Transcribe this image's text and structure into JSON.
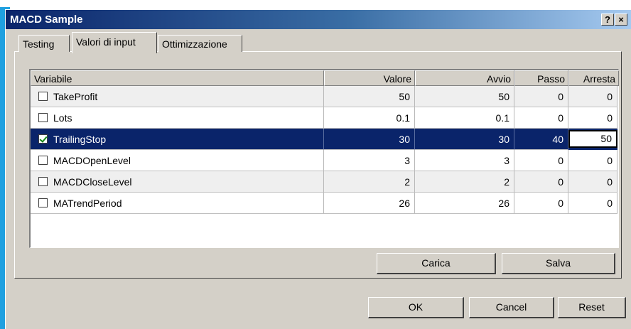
{
  "window": {
    "title": "MACD Sample",
    "help_label": "?",
    "close_label": "×"
  },
  "tabs": [
    {
      "label": "Testing"
    },
    {
      "label": "Valori di input"
    },
    {
      "label": "Ottimizzazione"
    }
  ],
  "table": {
    "columns": [
      "Variabile",
      "Valore",
      "Avvio",
      "Passo",
      "Arresta"
    ],
    "rows": [
      {
        "checked": false,
        "name": "TakeProfit",
        "valore": "50",
        "avvio": "50",
        "passo": "0",
        "arresta": "0"
      },
      {
        "checked": false,
        "name": "Lots",
        "valore": "0.1",
        "avvio": "0.1",
        "passo": "0",
        "arresta": "0"
      },
      {
        "checked": true,
        "name": "TrailingStop",
        "valore": "30",
        "avvio": "30",
        "passo": "40",
        "arresta": "50"
      },
      {
        "checked": false,
        "name": "MACDOpenLevel",
        "valore": "3",
        "avvio": "3",
        "passo": "0",
        "arresta": "0"
      },
      {
        "checked": false,
        "name": "MACDCloseLevel",
        "valore": "2",
        "avvio": "2",
        "passo": "0",
        "arresta": "0"
      },
      {
        "checked": false,
        "name": "MATrendPeriod",
        "valore": "26",
        "avvio": "26",
        "passo": "0",
        "arresta": "0"
      }
    ]
  },
  "buttons": {
    "carica": "Carica",
    "salva": "Salva",
    "ok": "OK",
    "cancel": "Cancel",
    "reset": "Reset"
  },
  "colors": {
    "title_bar_start": "#0a246a",
    "selection": "#0a246a",
    "face": "#d4d0c8",
    "check_mark": "#128712"
  }
}
